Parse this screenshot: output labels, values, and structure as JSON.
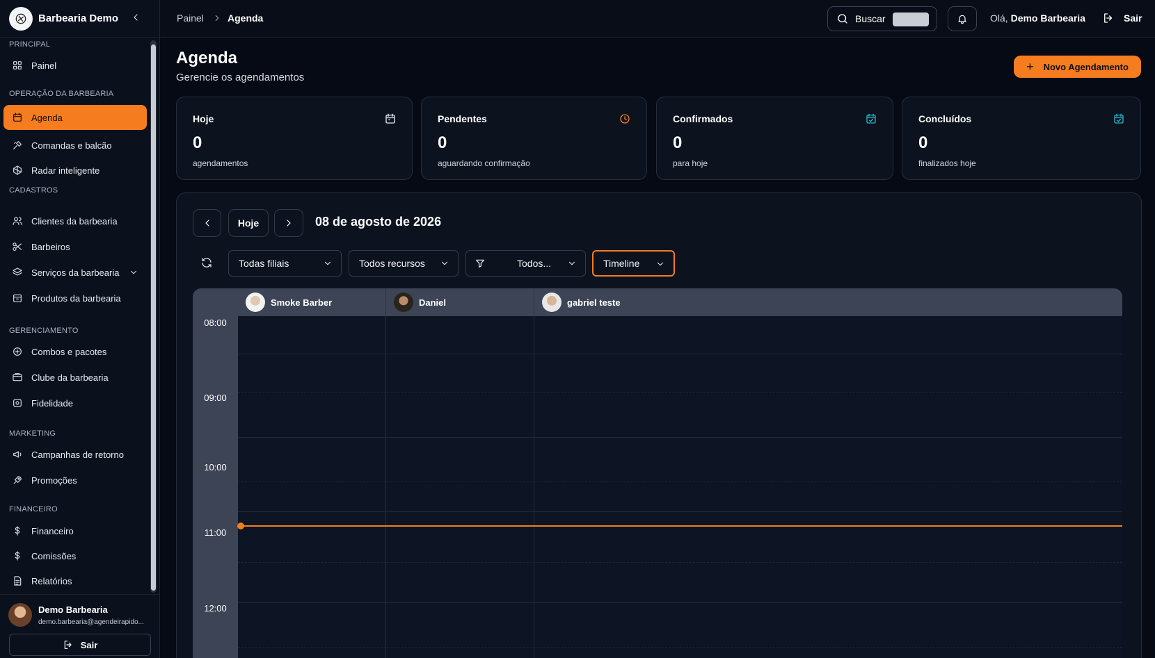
{
  "brand": {
    "name": "Barbearia Demo"
  },
  "sidebar": {
    "sections": {
      "principal": "PRINCIPAL",
      "operacao": "OPERAÇÃO DA BARBEARIA",
      "cadastros": "CADASTROS",
      "gerenciamento": "GERENCIAMENTO",
      "marketing": "MARKETING",
      "financeiro": "FINANCEIRO"
    },
    "items": {
      "painel": "Painel",
      "agenda": "Agenda",
      "comandas": "Comandas e balcão",
      "radar": "Radar inteligente",
      "clientes": "Clientes da barbearia",
      "barbeiros": "Barbeiros",
      "servicos": "Serviços da barbearia",
      "produtos": "Produtos da barbearia",
      "combos": "Combos e pacotes",
      "clube": "Clube da barbearia",
      "fidelidade": "Fidelidade",
      "campanhas": "Campanhas de retorno",
      "promocoes": "Promoções",
      "financeiro": "Financeiro",
      "comissoes": "Comissões",
      "relatorios": "Relatórios"
    },
    "user": {
      "name": "Demo Barbearia",
      "email": "demo.barbearia@agendeirapido..."
    },
    "logout_label": "Sair"
  },
  "topbar": {
    "breadcrumb": [
      "Painel",
      "Agenda"
    ],
    "search_label": "Buscar",
    "greeting_prefix": "Olá,",
    "greeting_name": "Demo Barbearia",
    "logout_label": "Sair"
  },
  "header": {
    "title": "Agenda",
    "subtitle": "Gerencie os agendamentos",
    "new_button": "Novo Agendamento"
  },
  "stats": [
    {
      "title": "Hoje",
      "value": "0",
      "sub": "agendamentos",
      "icon": "calendar-icon",
      "color": "#e8ecf3"
    },
    {
      "title": "Pendentes",
      "value": "0",
      "sub": "aguardando confirmação",
      "icon": "clock-icon",
      "color": "#f57c1f"
    },
    {
      "title": "Confirmados",
      "value": "0",
      "sub": "para hoje",
      "icon": "calendar-check-icon",
      "color": "#22b8c8"
    },
    {
      "title": "Concluídos",
      "value": "0",
      "sub": "finalizados hoje",
      "icon": "calendar-check-icon",
      "color": "#22b8c8"
    }
  ],
  "calendar": {
    "today_label": "Hoje",
    "date": "08 de agosto de 2026",
    "filters": {
      "branches": "Todas filiais",
      "resources": "Todos recursos",
      "status": "Todos...",
      "view": "Timeline"
    },
    "resources": [
      "Smoke Barber",
      "Daniel",
      "gabriel teste"
    ],
    "times": [
      "08:00",
      "09:00",
      "10:00",
      "11:00",
      "12:00"
    ]
  },
  "colors": {
    "accent": "#f57c1f",
    "background": "#060a14",
    "panel": "#0c121e"
  }
}
